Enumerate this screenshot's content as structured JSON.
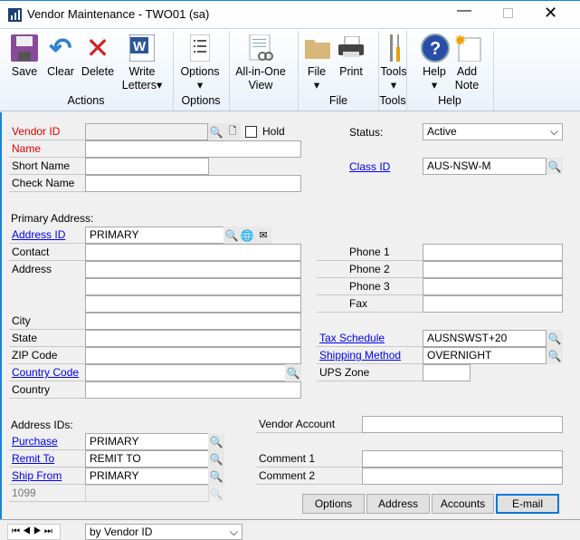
{
  "window": {
    "title": "Vendor Maintenance  -  TWO01 (sa)"
  },
  "ribbon": {
    "buttons": [
      {
        "label": "Save",
        "icon": "floppy-disk-icon"
      },
      {
        "label": "Clear",
        "icon": "undo-arrow-icon"
      },
      {
        "label": "Delete",
        "icon": "red-x-icon"
      },
      {
        "label": "Write",
        "label2": "Letters",
        "icon": "word-icon"
      },
      {
        "label": "Options",
        "icon": "checklist-icon"
      },
      {
        "label": "All-in-One",
        "label2": "View",
        "icon": "document-link-icon"
      },
      {
        "label": "File",
        "icon": "folder-icon"
      },
      {
        "label": "Print",
        "icon": "printer-icon"
      },
      {
        "label": "Tools",
        "icon": "tools-icon"
      },
      {
        "label": "Help",
        "icon": "help-icon"
      },
      {
        "label": "Add",
        "label2": "Note",
        "icon": "note-icon"
      }
    ],
    "groups": [
      "Actions",
      "Options",
      "File",
      "Tools",
      "Help"
    ]
  },
  "form": {
    "vendor_id": {
      "label": "Vendor ID",
      "value": ""
    },
    "hold": {
      "label": "Hold",
      "checked": false
    },
    "name": {
      "label": "Name",
      "value": ""
    },
    "short_name": {
      "label": "Short Name",
      "value": ""
    },
    "check_name": {
      "label": "Check Name",
      "value": ""
    },
    "primary_address_label": "Primary Address:",
    "address_id": {
      "label": "Address ID",
      "value": "PRIMARY"
    },
    "contact": {
      "label": "Contact",
      "value": ""
    },
    "address": {
      "label": "Address",
      "value": ""
    },
    "city": {
      "label": "City",
      "value": ""
    },
    "state": {
      "label": "State",
      "value": ""
    },
    "zip": {
      "label": "ZIP Code",
      "value": ""
    },
    "country_code": {
      "label": "Country Code",
      "value": ""
    },
    "country": {
      "label": "Country",
      "value": ""
    },
    "status": {
      "label": "Status:",
      "value": "Active"
    },
    "class_id": {
      "label": "Class ID",
      "value": "AUS-NSW-M"
    },
    "phone1": {
      "label": "Phone 1",
      "value": ""
    },
    "phone2": {
      "label": "Phone 2",
      "value": ""
    },
    "phone3": {
      "label": "Phone 3",
      "value": ""
    },
    "fax": {
      "label": "Fax",
      "value": ""
    },
    "tax_schedule": {
      "label": "Tax Schedule",
      "value": "AUSNSWST+20"
    },
    "shipping_method": {
      "label": "Shipping Method",
      "value": "OVERNIGHT"
    },
    "ups_zone": {
      "label": "UPS Zone",
      "value": ""
    },
    "address_ids_label": "Address IDs:",
    "purchase": {
      "label": "Purchase",
      "value": "PRIMARY"
    },
    "remit_to": {
      "label": "Remit To",
      "value": "REMIT TO"
    },
    "ship_from": {
      "label": "Ship From",
      "value": "PRIMARY"
    },
    "f1099": {
      "label": "1099",
      "value": ""
    },
    "vendor_account": {
      "label": "Vendor Account",
      "value": ""
    },
    "comment1": {
      "label": "Comment 1",
      "value": ""
    },
    "comment2": {
      "label": "Comment 2",
      "value": ""
    }
  },
  "buttons": {
    "options": "Options",
    "address": "Address",
    "accounts": "Accounts",
    "email": "E-mail"
  },
  "footer": {
    "sort": "by Vendor ID"
  },
  "colors": {
    "required": "#e00000",
    "link": "#0000ee",
    "accent": "#1883d7"
  }
}
